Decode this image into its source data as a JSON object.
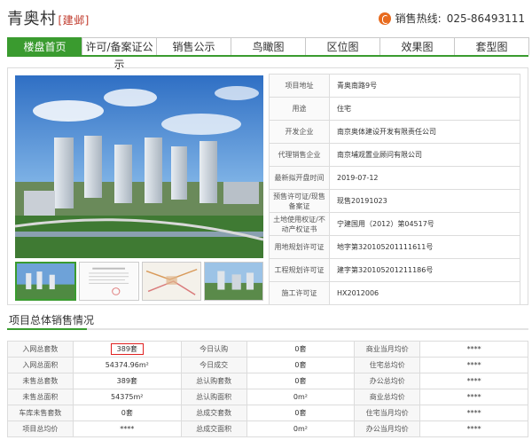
{
  "header": {
    "project_name": "青奥村",
    "district": "[建邺]",
    "hotline_label": "销售热线:",
    "hotline_number": "025-86493111"
  },
  "tabs": [
    {
      "label": "楼盘首页",
      "active": true
    },
    {
      "label": "许可/备案证公示",
      "active": false
    },
    {
      "label": "销售公示",
      "active": false
    },
    {
      "label": "鸟瞰图",
      "active": false
    },
    {
      "label": "区位图",
      "active": false
    },
    {
      "label": "效果图",
      "active": false
    },
    {
      "label": "套型图",
      "active": false
    }
  ],
  "info": [
    {
      "key": "项目地址",
      "value": "青奥南路9号"
    },
    {
      "key": "用途",
      "value": "住宅"
    },
    {
      "key": "开发企业",
      "value": "南京奥体建设开发有限责任公司"
    },
    {
      "key": "代理销售企业",
      "value": "南京埔观置业顾问有限公司"
    },
    {
      "key": "最新拟开盘时间",
      "value": "2019-07-12"
    },
    {
      "key": "预售许可证/现售备案证",
      "value": "现售20191023"
    },
    {
      "key": "土地使用权证/不动产权证书",
      "value": "宁建国用（2012）第04517号"
    },
    {
      "key": "用地规划许可证",
      "value": "地字第3201052011116​11号"
    },
    {
      "key": "工程规划许可证",
      "value": "建字第320105201211186号"
    },
    {
      "key": "施工许可证",
      "value": "HX2012006"
    }
  ],
  "section_title": "项目总体销售情况",
  "sales_rows": [
    [
      {
        "k": "入网总套数",
        "v": "389套"
      },
      {
        "k": "今日认购",
        "v": "0套"
      },
      {
        "k": "商业当月均价",
        "v": "****"
      }
    ],
    [
      {
        "k": "入网总面积",
        "v": "54374.96m²"
      },
      {
        "k": "今日成交",
        "v": "0套"
      },
      {
        "k": "住宅总均价",
        "v": "****"
      }
    ],
    [
      {
        "k": "未售总套数",
        "v": "389套"
      },
      {
        "k": "总认购套数",
        "v": "0套"
      },
      {
        "k": "办公总均价",
        "v": "****"
      }
    ],
    [
      {
        "k": "未售总面积",
        "v": "54375m²"
      },
      {
        "k": "总认购面积",
        "v": "0m²"
      },
      {
        "k": "商业总均价",
        "v": "****"
      }
    ],
    [
      {
        "k": "车库未售套数",
        "v": "0套"
      },
      {
        "k": "总成交套数",
        "v": "0套"
      },
      {
        "k": "住宅当月均价",
        "v": "****"
      }
    ],
    [
      {
        "k": "项目总均价",
        "v": "****"
      },
      {
        "k": "总成交面积",
        "v": "0m²"
      },
      {
        "k": "办公当月均价",
        "v": "****"
      }
    ]
  ],
  "colors": {
    "accent": "#3a9b2f",
    "highlight": "#e02020",
    "district": "#c0392b",
    "phone": "#e86b1f"
  },
  "icons": {
    "hotline": "phone-icon"
  }
}
